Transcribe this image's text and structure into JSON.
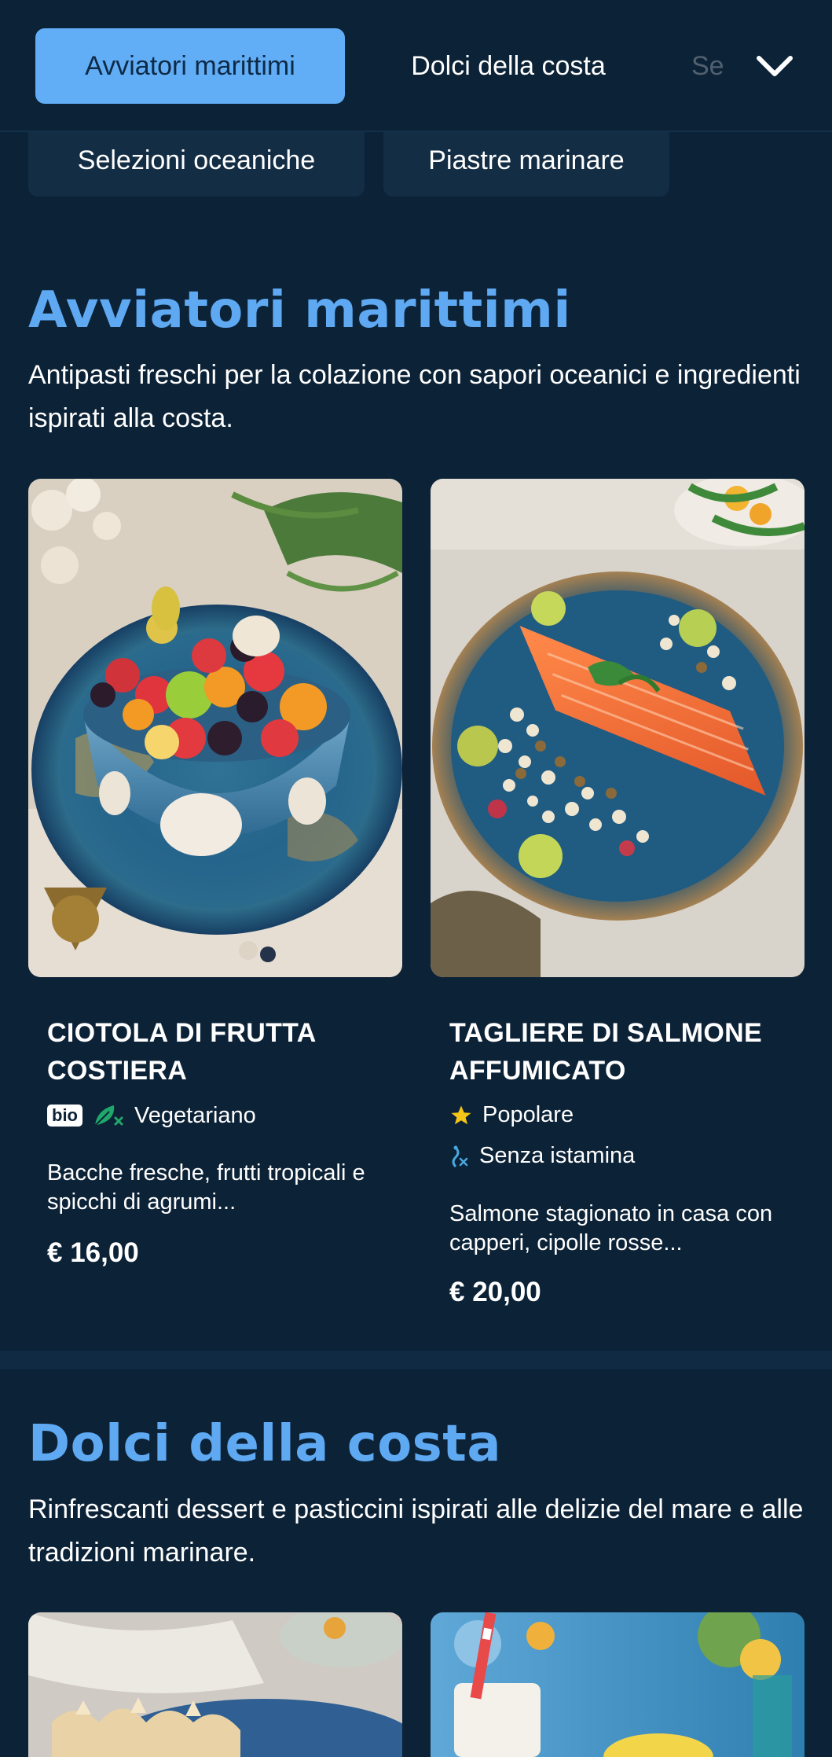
{
  "nav": {
    "tabs": [
      {
        "label": "Avviatori marittimi",
        "active": true
      },
      {
        "label": "Dolci della costa",
        "active": false
      },
      {
        "label": "Se",
        "active": false
      }
    ],
    "chips": [
      "Selezioni oceaniche",
      "Piastre marinare"
    ]
  },
  "sections": [
    {
      "title": "Avviatori marittimi",
      "description": "Antipasti freschi per la colazione con sapori oceanici e ingredienti ispirati alla costa.",
      "items": [
        {
          "title": "CIOTOLA DI FRUTTA COSTIERA",
          "tags": [
            {
              "badge": "bio"
            },
            {
              "icon": "vegetarian-leaf-icon",
              "label": "Vegetariano"
            }
          ],
          "description": "Bacche fresche, frutti tropicali e spicchi di agrumi...",
          "price": "€ 16,00"
        },
        {
          "title": "TAGLIERE DI SALMONE AFFUMICATO",
          "tags": [
            {
              "icon": "star-icon",
              "label": "Popolare"
            },
            {
              "icon": "histamine-free-icon",
              "label": "Senza istamina"
            }
          ],
          "description": "Salmone stagionato in casa con capperi, cipolle rosse...",
          "price": "€ 20,00"
        }
      ]
    },
    {
      "title": "Dolci della costa",
      "description": "Rinfrescanti dessert e pasticcini ispirati alle delizie del mare e alle tradizioni marinare."
    }
  ],
  "colors": {
    "background": "#0c2237",
    "accent": "#5ea9f2",
    "active_pill": "#62aef6",
    "chip": "#132d45",
    "star": "#f5c518",
    "leaf": "#1fa86a"
  }
}
